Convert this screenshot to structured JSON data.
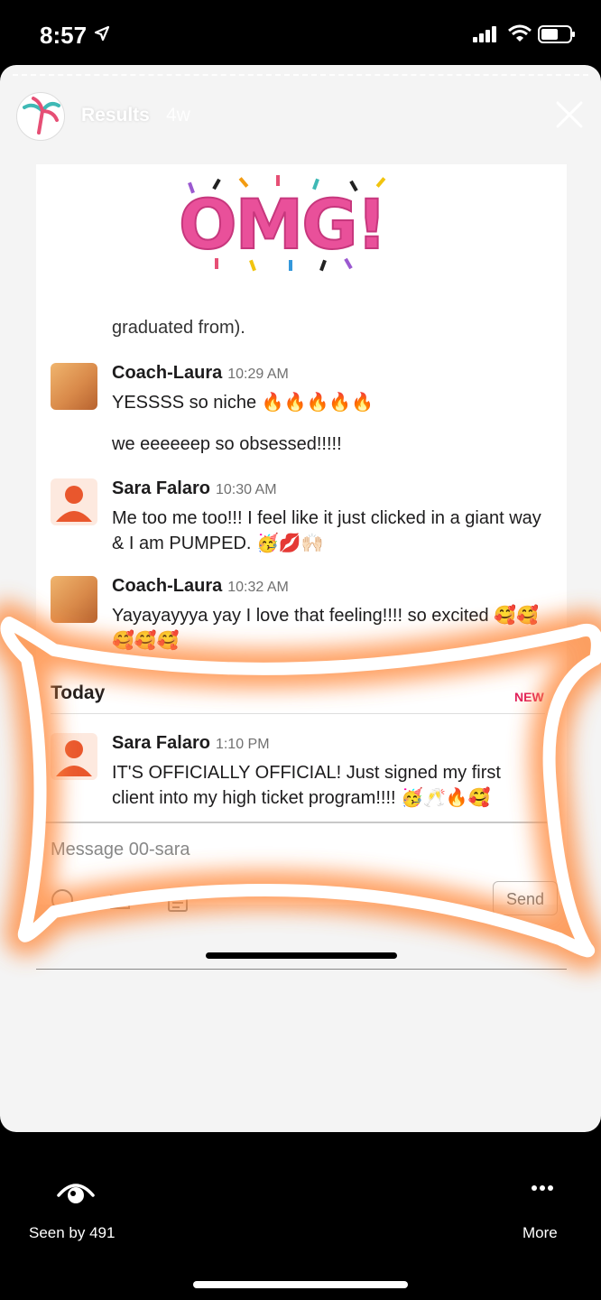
{
  "status": {
    "time": "8:57"
  },
  "story": {
    "title": "Results",
    "age": "4w",
    "seen": "Seen by 491",
    "more": "More"
  },
  "screenshot": {
    "banner": "OMG!",
    "cutoff": "graduated from).",
    "messages": [
      {
        "author": "Coach-Laura",
        "time": "10:29 AM",
        "lines": [
          "YESSSS so niche 🔥🔥🔥🔥🔥",
          "we eeeeeep so obsessed!!!!!"
        ]
      },
      {
        "author": "Sara Falaro",
        "time": "10:30 AM",
        "lines": [
          "Me too me too!!! I feel like it just clicked in a giant way & I am PUMPED. 🥳💋🙌🏻"
        ]
      },
      {
        "author": "Coach-Laura",
        "time": "10:32 AM",
        "lines": [
          "Yayayayyya yay I love that feeling!!!! so excited 🥰🥰🥰🥰🥰"
        ]
      },
      {
        "author": "Sara Falaro",
        "time": "1:10 PM",
        "lines": [
          "IT'S OFFICIALLY OFFICIAL! Just signed my first client into my high ticket program!!!! 🥳🥂🔥🥰"
        ]
      }
    ],
    "day_label": "Today",
    "new_label": "NEW",
    "placeholder": "Message 00-sara",
    "send_label": "Send"
  },
  "colors": {
    "glow": "#ff8a3c",
    "banner": "#e9509a",
    "new": "#e01e5a"
  }
}
